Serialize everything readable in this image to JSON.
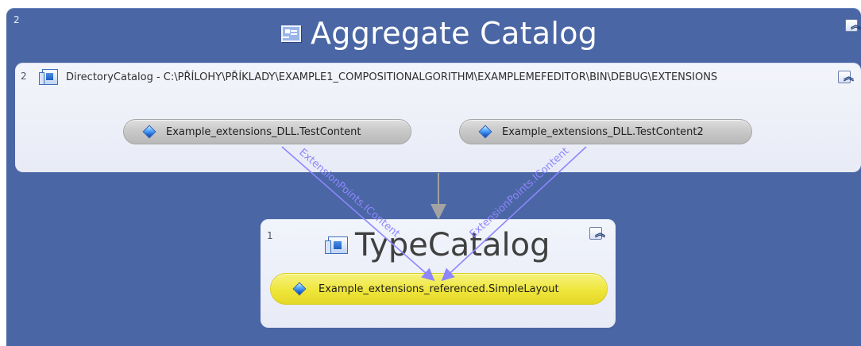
{
  "aggregate_catalog": {
    "count": "2",
    "title": "Aggregate Catalog",
    "icon": "catalog-icon",
    "collapse_label": "︽"
  },
  "directory_catalog": {
    "count": "2",
    "title": "DirectoryCatalog - C:\\PŘÍLOHY\\PŘÍKLADY\\EXAMPLE1_COMPOSITIONALGORITHM\\EXAMPLEMEFEDITOR\\BIN\\DEBUG\\EXTENSIONS",
    "icon": "directory-catalog-icon",
    "collapse_label": "︽",
    "parts": [
      {
        "label": "Example_extensions_DLL.TestContent",
        "icon": "part-icon"
      },
      {
        "label": "Example_extensions_DLL.TestContent2",
        "icon": "part-icon"
      }
    ]
  },
  "type_catalog": {
    "count": "1",
    "title": "TypeCatalog",
    "icon": "type-catalog-icon",
    "collapse_label": "︽",
    "part": {
      "label": "Example_extensions_referenced.SimpleLayout",
      "icon": "part-icon"
    }
  },
  "connections": {
    "left_label": "ExtensionPoints.IContent",
    "right_label": "ExtensionPoints.IContent",
    "edge_color": "#8d86ff",
    "container_edge_color": "#a3a3a3"
  }
}
